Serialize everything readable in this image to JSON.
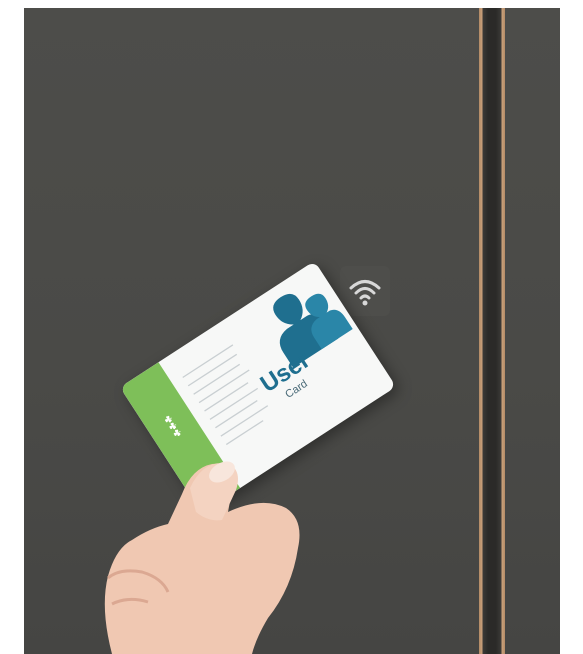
{
  "card": {
    "title": "User",
    "subtitle": "Card"
  },
  "colors": {
    "door": "#4b4b48",
    "card_accent_blue": "#1f6f8f",
    "card_stripe_green": "#7ebf59",
    "trim_wood": "#c9a07a"
  },
  "icons": [
    "wireless-signal-icon",
    "users-icon"
  ]
}
